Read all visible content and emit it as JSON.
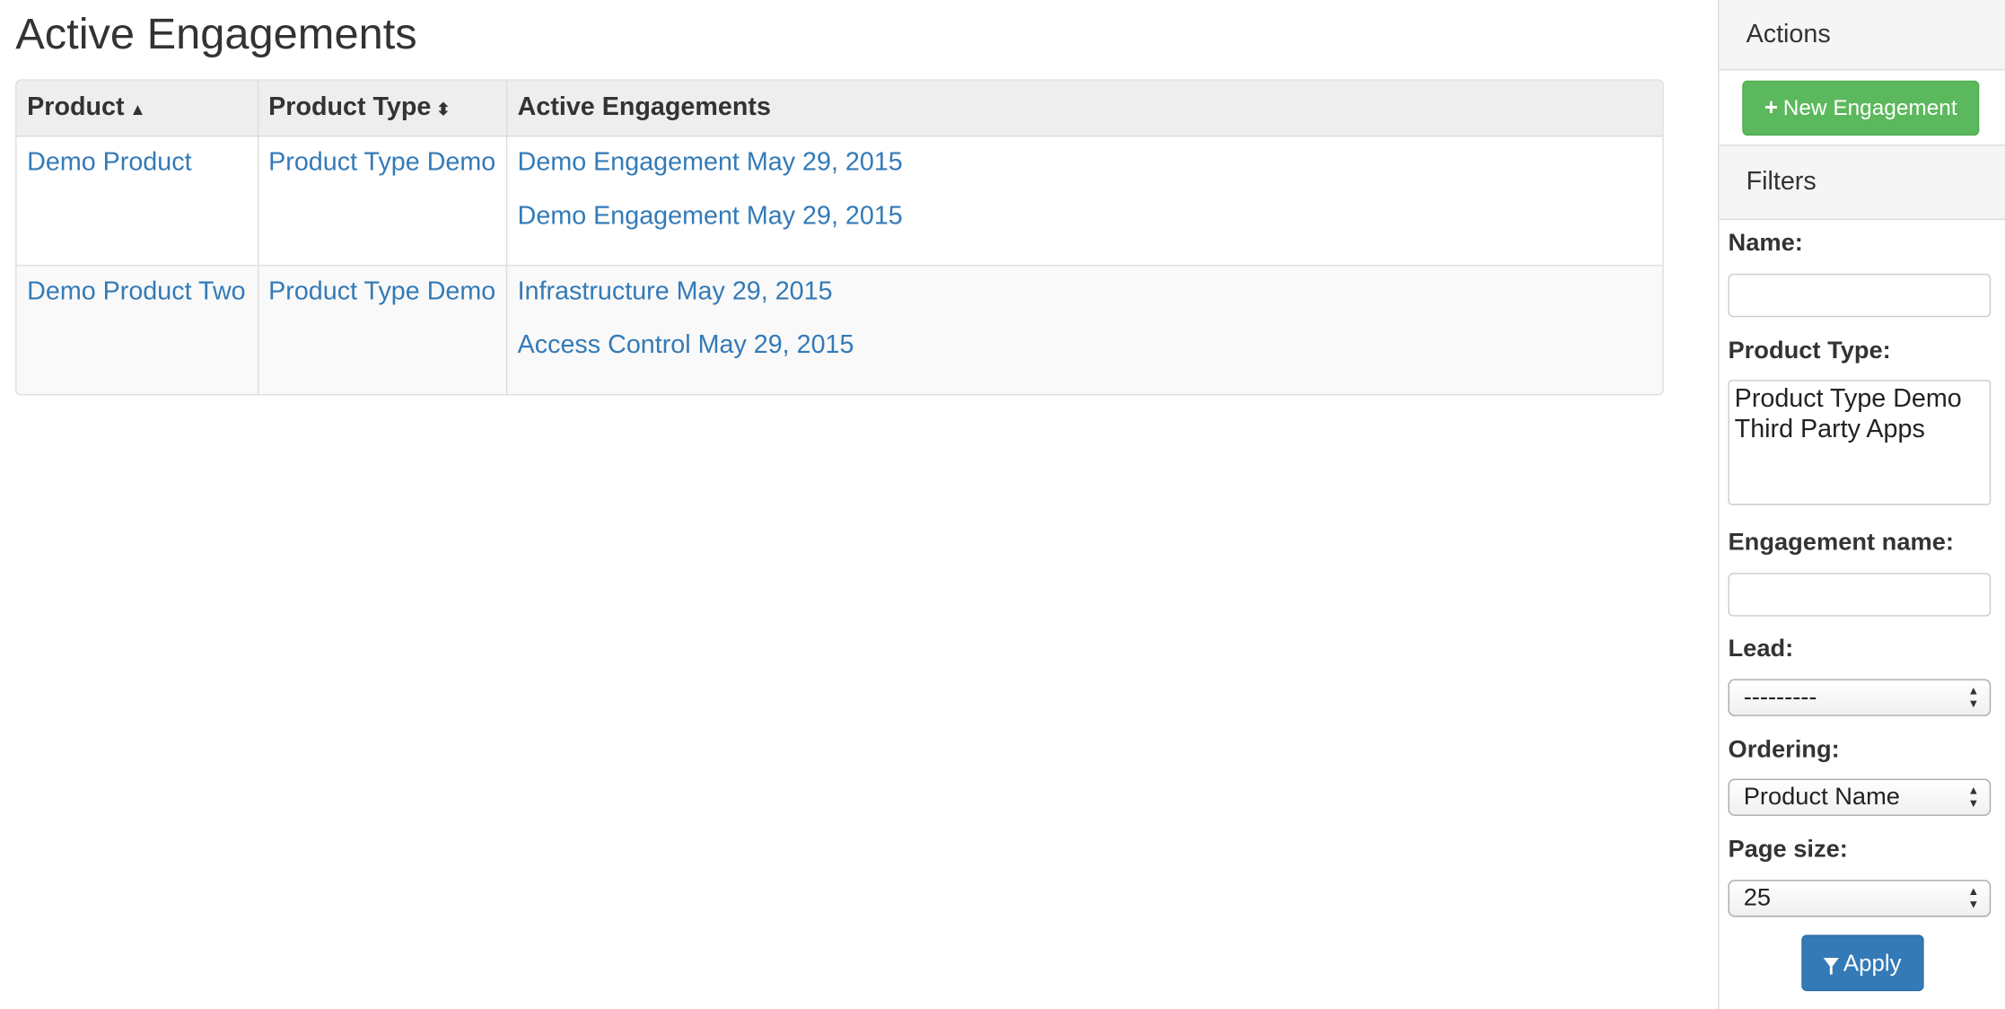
{
  "page": {
    "title": "Active Engagements"
  },
  "table": {
    "headers": {
      "product": "Product",
      "product_type": "Product Type",
      "active_engagements": "Active Engagements"
    },
    "sort_icons": {
      "product": "▲",
      "product_type": "⬍"
    },
    "rows": [
      {
        "product": "Demo Product",
        "product_type": "Product Type Demo",
        "engagements": [
          "Demo Engagement May 29, 2015",
          "Demo Engagement May 29, 2015"
        ]
      },
      {
        "product": "Demo Product Two",
        "product_type": "Product Type Demo",
        "engagements": [
          "Infrastructure May 29, 2015",
          "Access Control May 29, 2015"
        ]
      }
    ]
  },
  "sidebar": {
    "actions_title": "Actions",
    "new_engagement_label": "New Engagement",
    "filters_title": "Filters",
    "filters": {
      "name_label": "Name:",
      "name_value": "",
      "product_type_label": "Product Type:",
      "product_type_options": [
        "Product Type Demo",
        "Third Party Apps"
      ],
      "engagement_name_label": "Engagement name:",
      "engagement_name_value": "",
      "lead_label": "Lead:",
      "lead_value": "---------",
      "ordering_label": "Ordering:",
      "ordering_value": "Product Name",
      "page_size_label": "Page size:",
      "page_size_value": "25"
    },
    "apply_label": "Apply"
  },
  "colors": {
    "link": "#337ab7",
    "success": "#5cb85c",
    "primary": "#337ab7",
    "header_bg": "#eeeeee"
  }
}
